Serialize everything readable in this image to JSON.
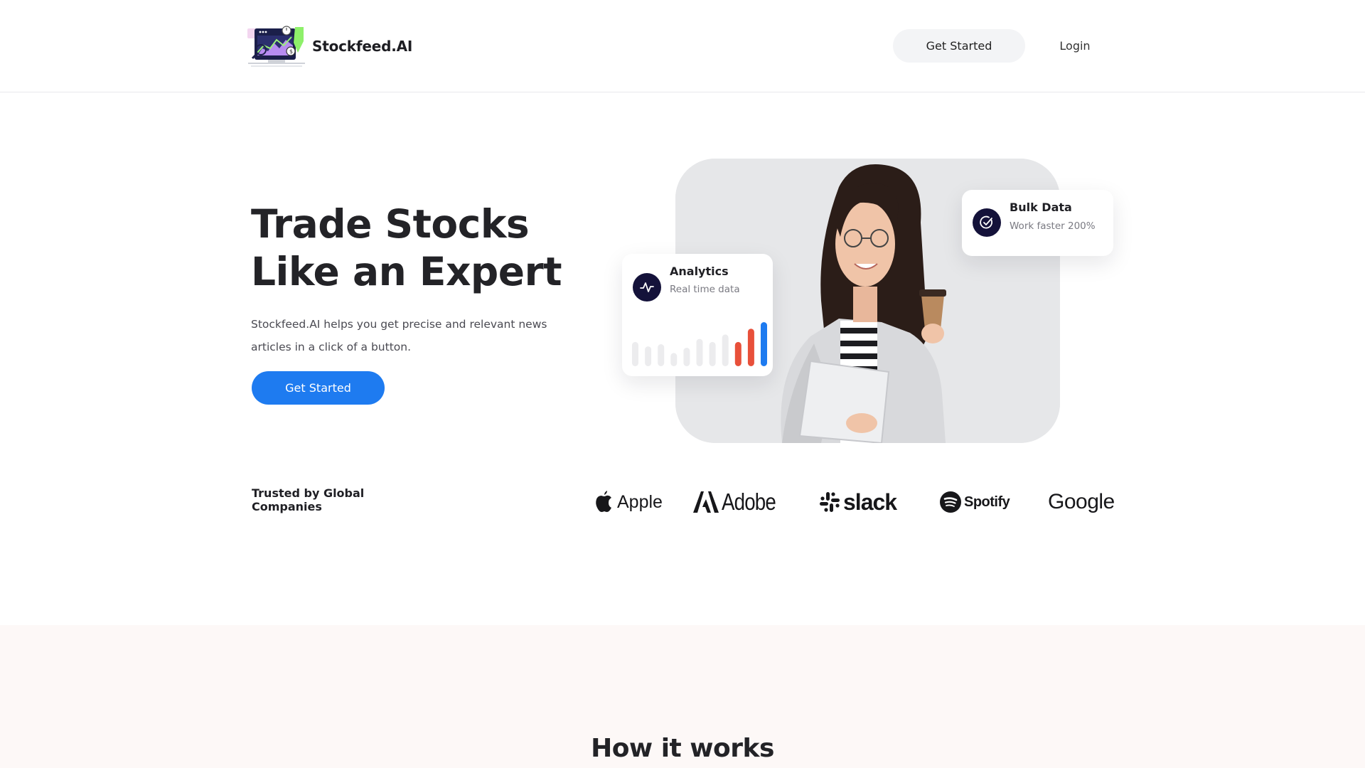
{
  "header": {
    "brand_name": "Stockfeed.AI",
    "get_started_label": "Get Started",
    "login_label": "Login"
  },
  "hero": {
    "title_line1": "Trade Stocks",
    "title_line2": "Like an Expert",
    "description": "Stockfeed.AI helps you get precise and relevant news articles in a click of a button.",
    "cta_label": "Get Started"
  },
  "cards": {
    "analytics": {
      "title": "Analytics",
      "subtitle": "Real time data",
      "icon": "activity-pulse-icon",
      "bar_values": [
        0.55,
        0.45,
        0.5,
        0.3,
        0.42,
        0.62,
        0.55,
        0.72,
        0.55,
        0.85,
        1.0
      ],
      "bar_colors": [
        "#ececee",
        "#ececee",
        "#ececee",
        "#ececee",
        "#ececee",
        "#ececee",
        "#ececee",
        "#ececee",
        "#e8503a",
        "#e8503a",
        "#1e7bf0"
      ]
    },
    "bulk": {
      "title": "Bulk Data",
      "subtitle": "Work faster 200%",
      "icon": "check-circle-icon"
    }
  },
  "trusted": {
    "label": "Trusted by Global Companies",
    "companies": [
      "Apple",
      "Adobe",
      "slack",
      "Spotify",
      "Google"
    ]
  },
  "how_it_works": {
    "title": "How it works"
  },
  "colors": {
    "primary": "#1e7bf0",
    "dark_icon_bg": "#14123a",
    "bar_red": "#e8503a",
    "section_bg": "#fdf8f7"
  }
}
